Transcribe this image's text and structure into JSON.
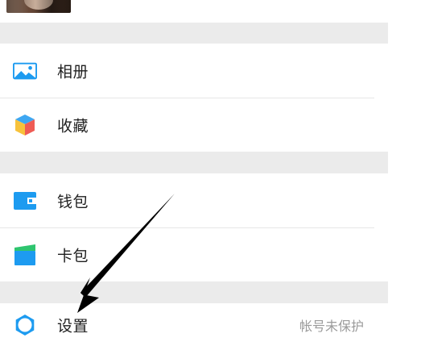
{
  "menu": {
    "album": {
      "label": "相册",
      "icon": "album-icon"
    },
    "favorites": {
      "label": "收藏",
      "icon": "favorites-cube-icon"
    },
    "wallet": {
      "label": "钱包",
      "icon": "wallet-icon"
    },
    "cards": {
      "label": "卡包",
      "icon": "card-holder-icon"
    },
    "settings": {
      "label": "设置",
      "icon": "gear-icon",
      "status": "帐号未保护"
    }
  },
  "colors": {
    "blue": "#1d9bf0",
    "divider": "#ebebeb",
    "text": "#1f1f1f",
    "muted": "#9b9b9b",
    "cube_top": "#3ea7f2",
    "cube_left": "#f7c23b",
    "cube_right": "#ef5c55",
    "card_green": "#2ec56f"
  }
}
